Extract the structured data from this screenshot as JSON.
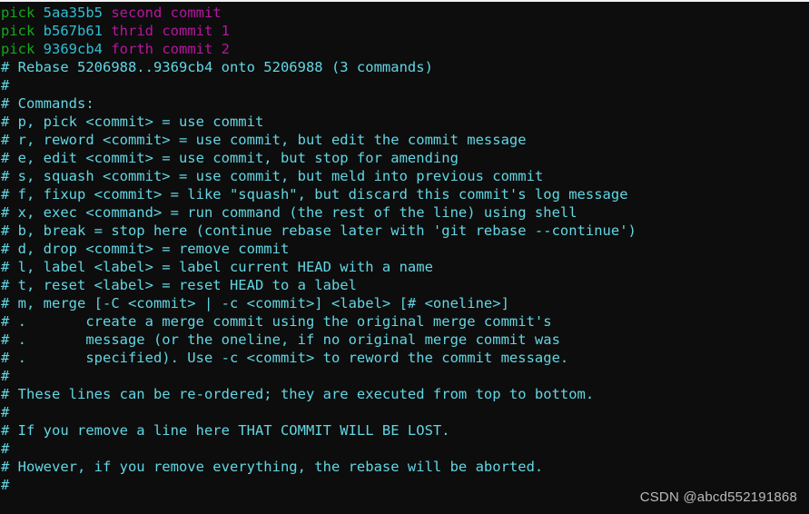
{
  "window": {
    "title": "git rebase -i todo editor",
    "background_color": "#0d0d0d"
  },
  "colors": {
    "command_keyword": "#17a81a",
    "commit_hash": "#2fbfd4",
    "commit_message": "#b5179e",
    "comment": "#62d6e3",
    "watermark": "#c9c9c9",
    "background": "#0d0d0d"
  },
  "todo": {
    "commits": [
      {
        "command": "pick",
        "hash": "5aa35b5",
        "message": "second commit"
      },
      {
        "command": "pick",
        "hash": "b567b61",
        "message": "thrid commit 1"
      },
      {
        "command": "pick",
        "hash": "9369cb4",
        "message": "forth commit 2"
      }
    ]
  },
  "comments": [
    "# Rebase 5206988..9369cb4 onto 5206988 (3 commands)",
    "#",
    "# Commands:",
    "# p, pick <commit> = use commit",
    "# r, reword <commit> = use commit, but edit the commit message",
    "# e, edit <commit> = use commit, but stop for amending",
    "# s, squash <commit> = use commit, but meld into previous commit",
    "# f, fixup <commit> = like \"squash\", but discard this commit's log message",
    "# x, exec <command> = run command (the rest of the line) using shell",
    "# b, break = stop here (continue rebase later with 'git rebase --continue')",
    "# d, drop <commit> = remove commit",
    "# l, label <label> = label current HEAD with a name",
    "# t, reset <label> = reset HEAD to a label",
    "# m, merge [-C <commit> | -c <commit>] <label> [# <oneline>]",
    "# .       create a merge commit using the original merge commit's",
    "# .       message (or the oneline, if no original merge commit was",
    "# .       specified). Use -c <commit> to reword the commit message.",
    "#",
    "# These lines can be re-ordered; they are executed from top to bottom.",
    "#",
    "# If you remove a line here THAT COMMIT WILL BE LOST.",
    "#",
    "# However, if you remove everything, the rebase will be aborted.",
    "#"
  ],
  "watermark": {
    "text": "CSDN @abcd552191868"
  }
}
